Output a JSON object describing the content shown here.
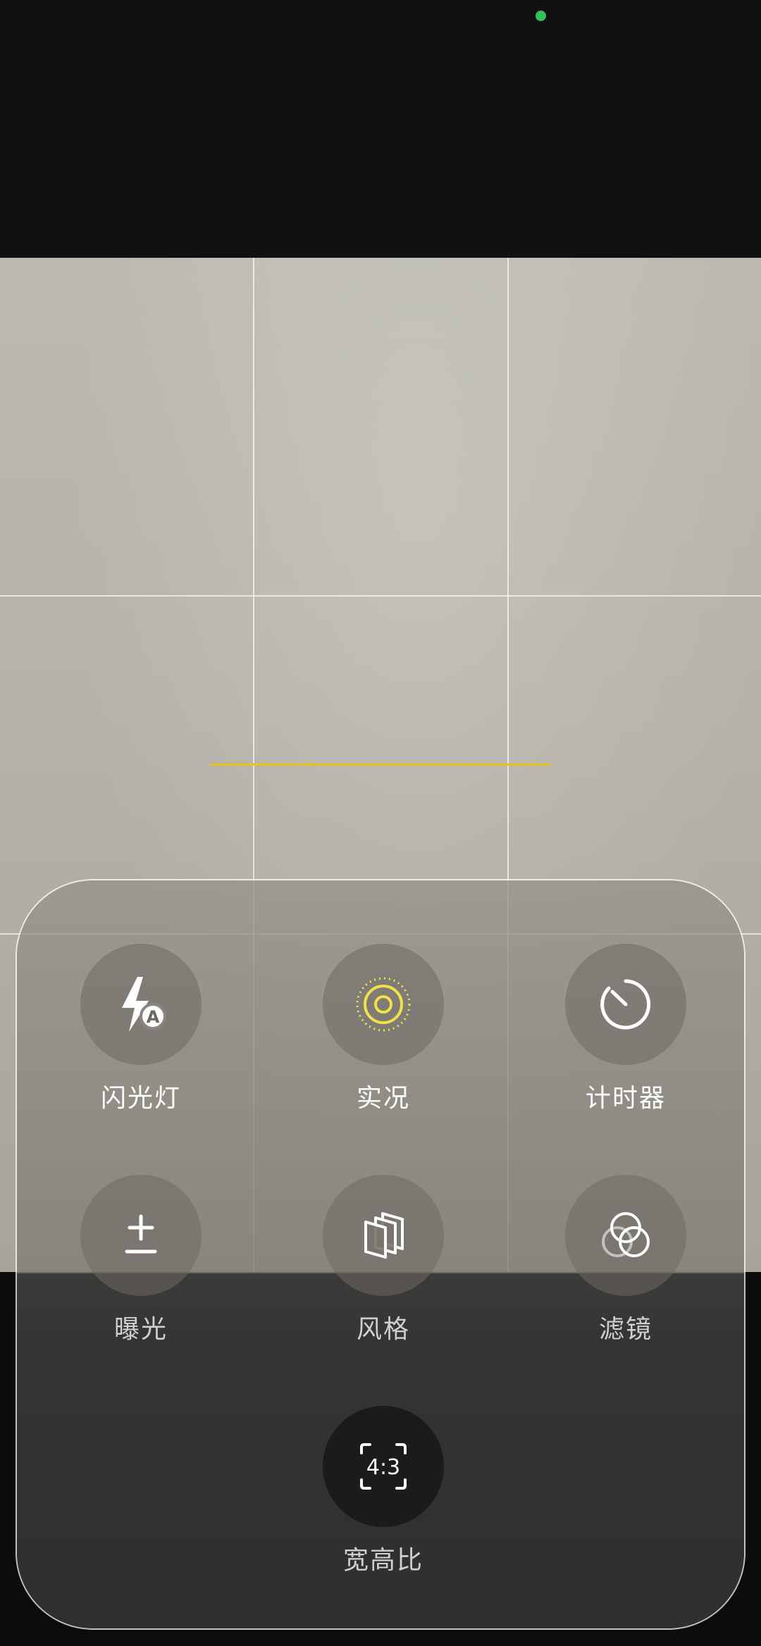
{
  "controls": {
    "flash": {
      "label": "闪光灯",
      "icon": "flash-auto-icon",
      "badge": "A"
    },
    "live": {
      "label": "实况",
      "icon": "live-photo-icon",
      "accent": "#f2e24a"
    },
    "timer": {
      "label": "计时器",
      "icon": "timer-icon"
    },
    "exposure": {
      "label": "曝光",
      "icon": "exposure-plus-minus-icon"
    },
    "styles": {
      "label": "风格",
      "icon": "photographic-styles-icon"
    },
    "filters": {
      "label": "滤镜",
      "icon": "filters-icon"
    },
    "aspect": {
      "label": "宽高比",
      "icon": "aspect-ratio-icon",
      "value": "4:3"
    }
  },
  "colors": {
    "level_line": "#e7c21a",
    "privacy_indicator": "#30c25a",
    "live_accent": "#f2e24a"
  }
}
